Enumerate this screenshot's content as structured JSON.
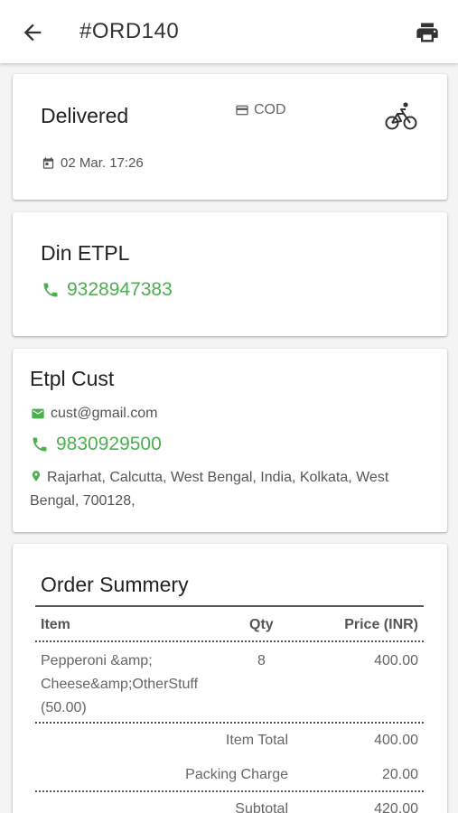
{
  "header": {
    "order_id": "#ORD140",
    "back_icon": "arrow-left-icon",
    "print_icon": "printer-icon"
  },
  "status_card": {
    "status": "Delivered",
    "payment_method": "COD",
    "payment_icon": "credit-card-icon",
    "delivery_icon": "bicycle-icon",
    "datetime": "02 Mar. 17:26",
    "datetime_icon": "calendar-icon"
  },
  "store_card": {
    "name": "Din ETPL",
    "phone": "9328947383",
    "phone_icon": "phone-icon"
  },
  "customer_card": {
    "name": "Etpl Cust",
    "email": "cust@gmail.com",
    "email_icon": "email-icon",
    "phone": "9830929500",
    "phone_icon": "phone-icon",
    "address": "Rajarhat, Calcutta, West Bengal, India, Kolkata, West Bengal, 700128,",
    "address_icon": "location-pin-icon"
  },
  "order_summary": {
    "title": "Order Summery",
    "columns": {
      "item": "Item",
      "qty": "Qty",
      "price": "Price (INR)"
    },
    "items": [
      {
        "name": "Pepperoni &amp; Cheese&amp;OtherStuff (50.00)",
        "qty": "8",
        "price": "400.00"
      }
    ],
    "totals": [
      {
        "label": "Item Total",
        "value": "400.00"
      },
      {
        "label": "Packing Charge",
        "value": "20.00"
      },
      {
        "label": "Subtotal",
        "value": "420.00"
      }
    ]
  },
  "colors": {
    "accent_green": "#4caf50",
    "text_dark": "#212121",
    "text_muted": "#666666"
  }
}
